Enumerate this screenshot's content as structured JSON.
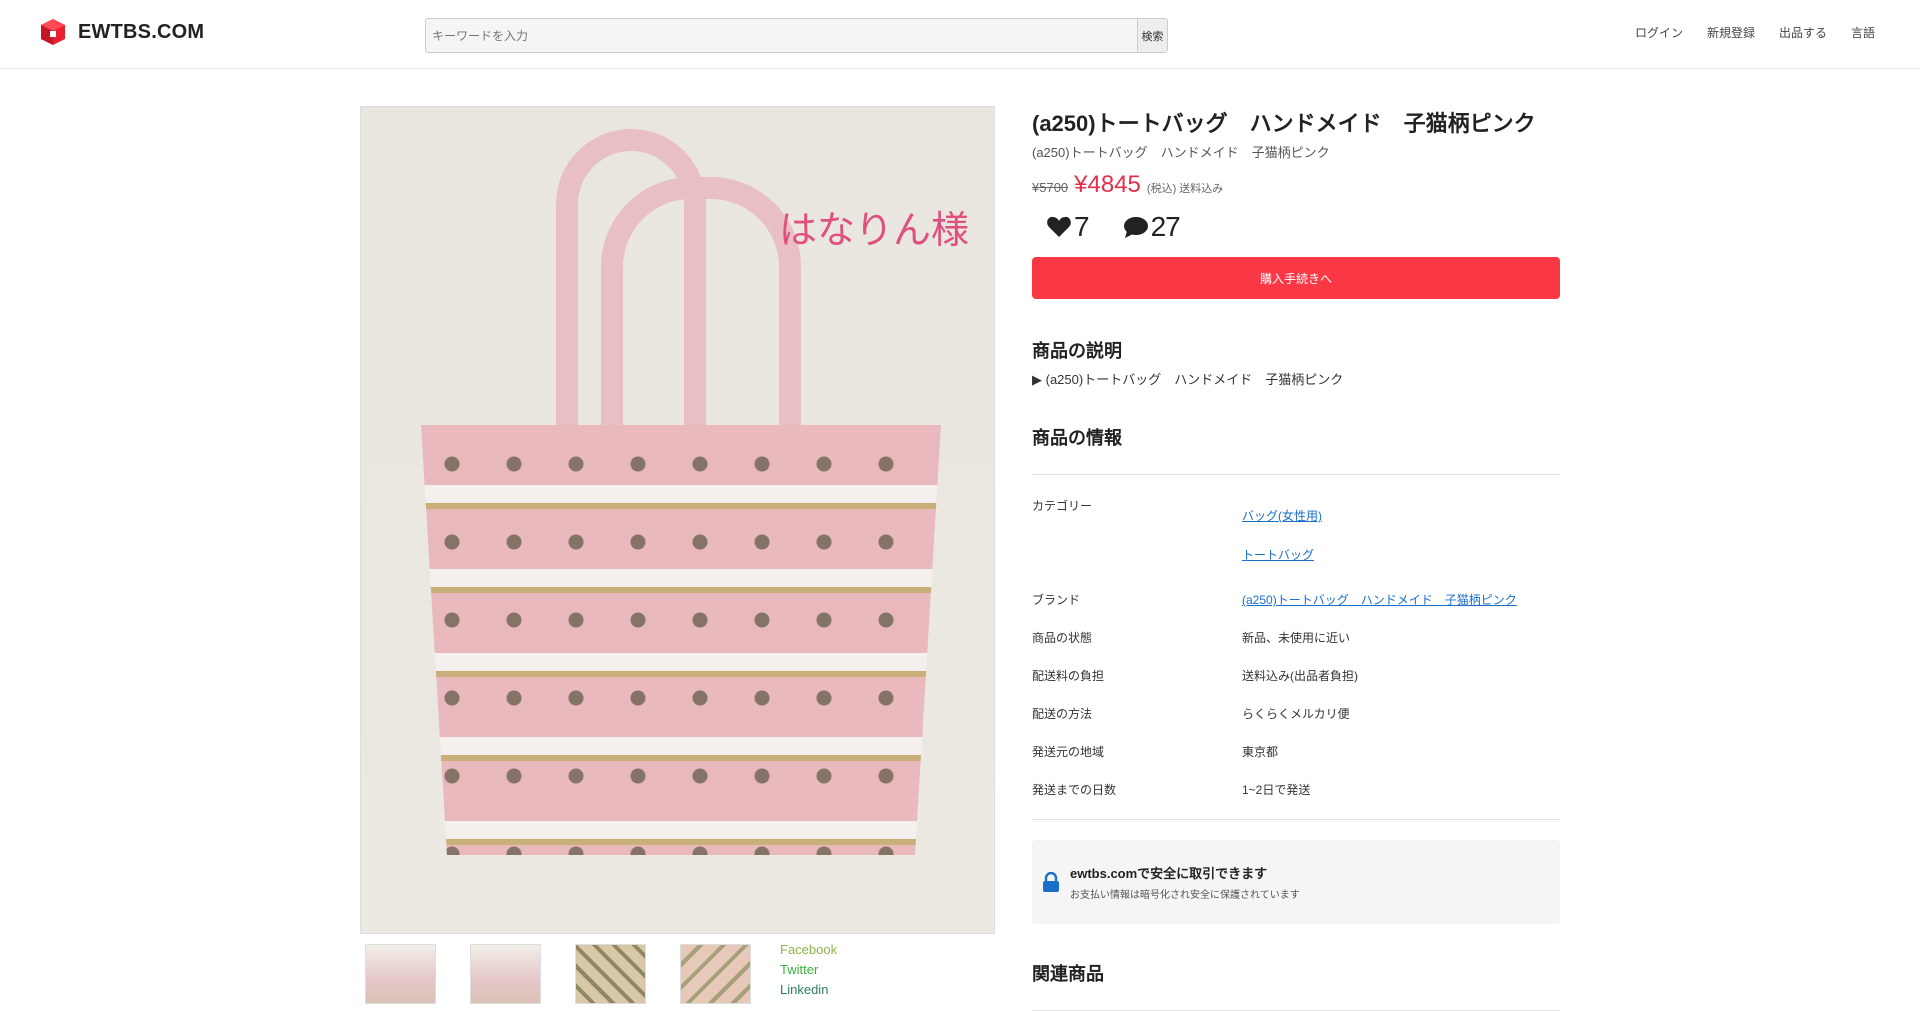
{
  "header": {
    "logo_text": "EWTBS.COM",
    "search_placeholder": "キーワードを入力",
    "search_button": "検索",
    "nav": [
      "ログイン",
      "新規登録",
      "出品する",
      "言語"
    ]
  },
  "product": {
    "watermark": "はなりん様",
    "title": "(a250)トートバッグ　ハンドメイド　子猫柄ピンク",
    "subtitle": "(a250)トートバッグ　ハンドメイド　子猫柄ピンク",
    "price_old": "¥5700",
    "price_new": "¥4845",
    "price_note": "(税込) 送料込み",
    "likes": "7",
    "comments": "27",
    "buy_label": "購入手続きへ"
  },
  "description": {
    "heading": "商品の説明",
    "toggle": "▶ (a250)トートバッグ　ハンドメイド　子猫柄ピンク"
  },
  "details": {
    "heading": "商品の情報",
    "category_key": "カテゴリー",
    "category_links": [
      "バッグ(女性用)",
      "トートバッグ"
    ],
    "brand_key": "ブランド",
    "brand_value": "(a250)トートバッグ　ハンドメイド　子猫柄ピンク",
    "condition_key": "商品の状態",
    "condition_value": "新品、未使用に近い",
    "shipping_fee_key": "配送料の負担",
    "shipping_fee_value": "送料込み(出品者負担)",
    "shipping_method_key": "配送の方法",
    "shipping_method_value": "らくらくメルカリ便",
    "origin_key": "発送元の地域",
    "origin_value": "東京都",
    "days_key": "発送までの日数",
    "days_value": "1~2日で発送"
  },
  "secure": {
    "title": "ewtbs.comで安全に取引できます",
    "sub": "お支払い情報は暗号化され安全に保護されています"
  },
  "similar": {
    "heading": "関連商品"
  },
  "share": {
    "facebook": "Facebook",
    "twitter": "Twitter",
    "linkedin": "Linkedin"
  },
  "colors": {
    "accent": "#f93745",
    "price": "#e0304b",
    "link": "#1a6fc9"
  }
}
